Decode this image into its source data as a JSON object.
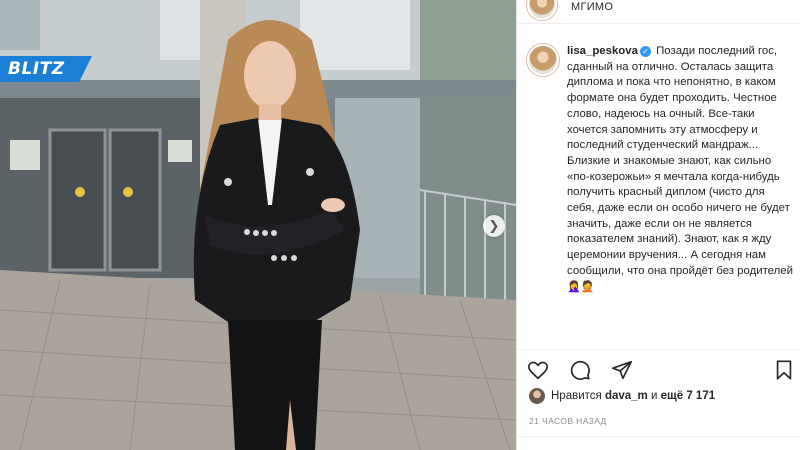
{
  "watermark": {
    "text": "BLITZ",
    "color": "#1c7fd6"
  },
  "post": {
    "location": "МГИМО",
    "username": "lisa_peskova",
    "verified_icon": "verified-badge-icon",
    "caption": "Позади последний гос, сданный на отлично. Осталась защита диплома и пока что непонятно, в каком формате она будет проходить. Честное слово, надеюсь на очный. Все-таки хочется запомнить эту атмосферу и последний студенческий мандраж... Близкие и знакомые знают, как сильно «по-козерожьи» я мечтала когда-нибудь получить красный диплом (чисто для себя, даже если он особо ничего не будет значить, даже если он не является показателем знаний). Знают, как я жду церемонии вручения... А сегодня нам сообщили, что она пройдёт без родителей",
    "caption_emoji": "🤦‍♀️🤦"
  },
  "actions": {
    "like_icon": "heart-icon",
    "comment_icon": "comment-icon",
    "share_icon": "share-icon",
    "save_icon": "bookmark-icon"
  },
  "likes": {
    "prefix": "Нравится",
    "user": "dava_m",
    "joiner": "и",
    "others": "ещё 7 171"
  },
  "timestamp": "21 ЧАСОВ НАЗАД",
  "colors": {
    "verified": "#3897f0",
    "text": "#262626",
    "muted": "#8e8e8e"
  }
}
